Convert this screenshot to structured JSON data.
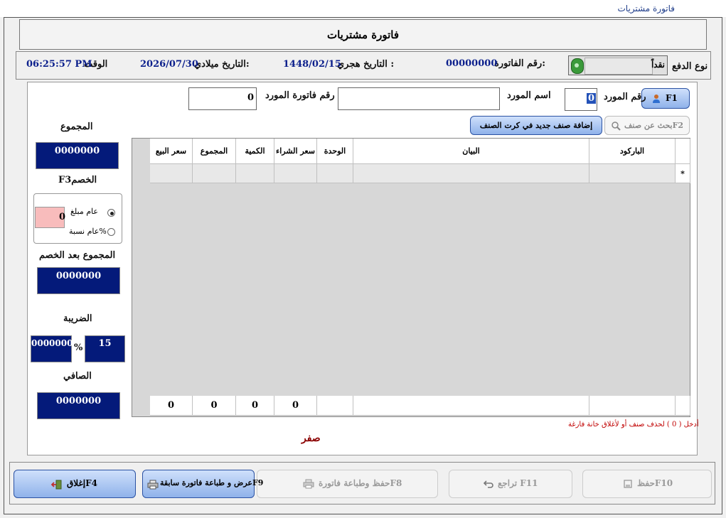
{
  "window": {
    "title": "فاتورة مشتريات"
  },
  "header": {
    "title": "فاتورة مشتريات"
  },
  "info": {
    "payment_label": "نوع الدفع",
    "payment_value": "نقداً",
    "invoice_no_label": "رقم الفاتورة:",
    "invoice_no": "00000000",
    "hijri_label": "التاريخ هجري :",
    "hijri_date": "1448/02/15",
    "greg_label": "التاريخ ميلادي:",
    "greg_date": "2026/07/30",
    "time_label": "الوقت",
    "time": "06:25:57 PM"
  },
  "supplier": {
    "f1_label": "F1",
    "no_label": "رقم المورد",
    "no_value": "0",
    "name_label": "اسم المورد",
    "name_value": "",
    "inv_label": "رقم فاتورة المورد",
    "inv_value": "0"
  },
  "toolbar": {
    "search_label": "بحث عن صنفF2",
    "add_item_label": "إضافة صنف جديد في كرت الصنف"
  },
  "grid": {
    "columns": [
      "الباركود",
      "البيان",
      "الوحدة",
      "سعر الشراء",
      "الكمية",
      "المجموع",
      "سعر البيع"
    ],
    "new_row_marker": "*",
    "totals": [
      "0",
      "0",
      "0",
      "0"
    ]
  },
  "summary": {
    "total_label": "المجموع",
    "total_value": "0000000",
    "discount_label": "F3الخصم",
    "discount_value": "0",
    "radio_amount": "عام مبلغ",
    "radio_percent": "عام نسبة%",
    "after_discount_label": "المجموع بعد الخصم",
    "after_discount_value": "0000000",
    "tax_label": "الضريبة",
    "tax_rate": "15",
    "tax_pct": "%",
    "tax_value": "0000000",
    "net_label": "الصافي",
    "net_value": "0000000"
  },
  "hint": "أدخل ( 0 ) لحذف صنف أو لأغلاق خانة فارغة",
  "amount_words": "صفر",
  "buttons": {
    "save": "حفظF10",
    "undo": "تراجع F11",
    "save_print": "حفظ وطباعة فاتورةF8",
    "view_prev": "عرض و طباعة فاتورة سابقةF9",
    "close": "إغلاقF4"
  },
  "colors": {
    "navy": "#041a7a",
    "accent_blue": "#0b1f8c",
    "hint_red": "#c00000",
    "words_red": "#8b0000"
  }
}
